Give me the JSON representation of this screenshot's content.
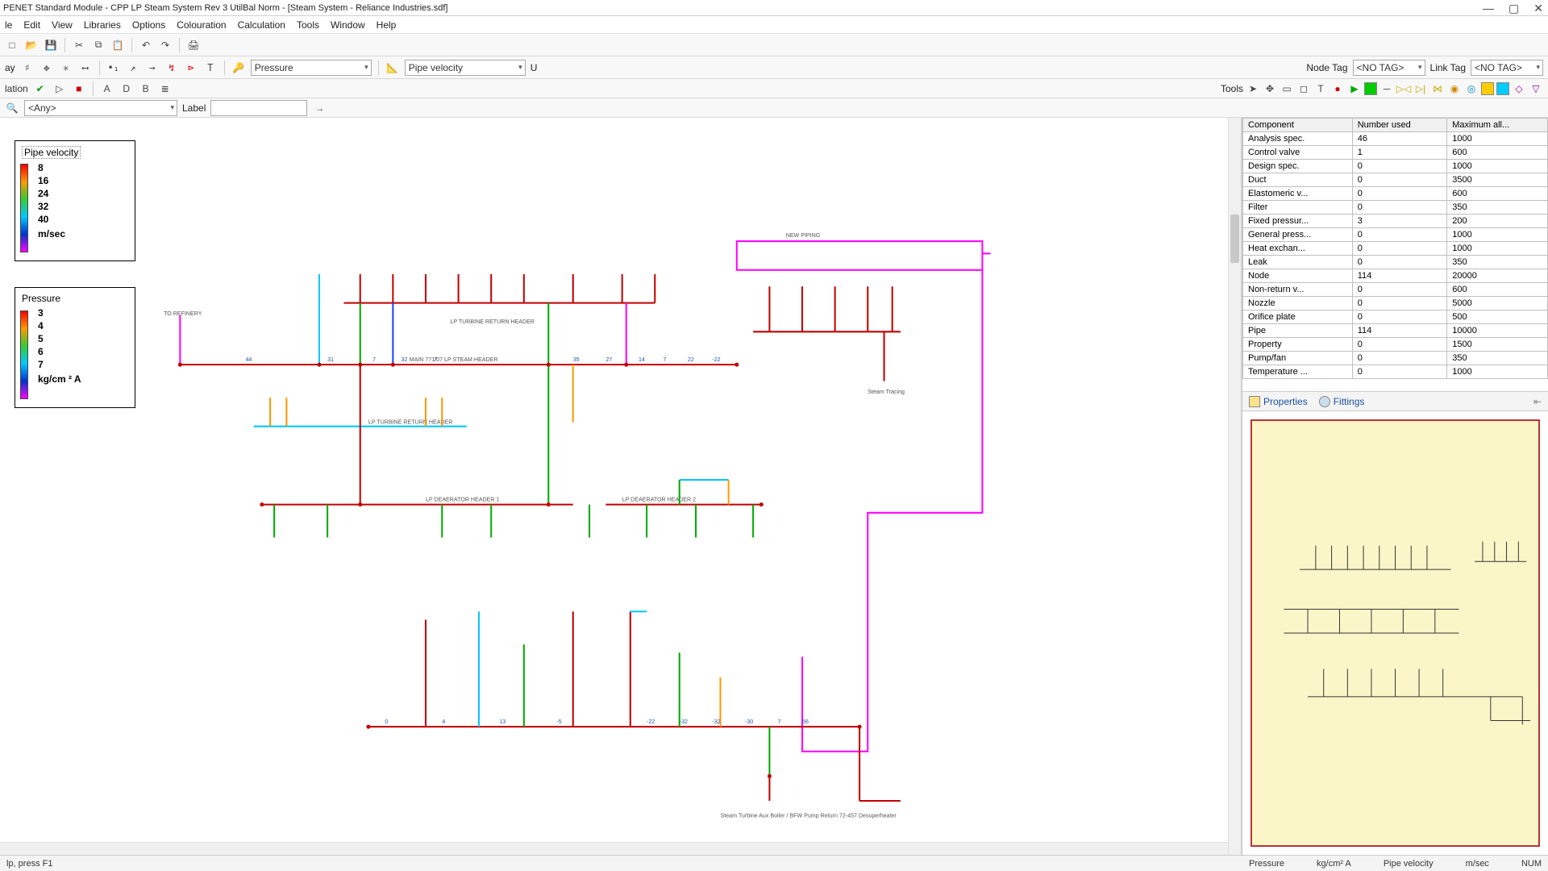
{
  "window": {
    "title": "PENET Standard Module - CPP LP Steam System Rev 3 UtilBal Norm - [Steam System - Reliance Industries.sdf]"
  },
  "menu": [
    "le",
    "Edit",
    "View",
    "Libraries",
    "Options",
    "Colouration",
    "Calculation",
    "Tools",
    "Window",
    "Help"
  ],
  "toolbar1": {
    "new": "□",
    "open": "📂",
    "save": "💾",
    "cut": "✂",
    "copy": "⧉",
    "paste": "📋",
    "undo": "↶",
    "redo": "↷",
    "print": "🖨"
  },
  "toolbar2": {
    "left_label": "ay",
    "combo1": "Pressure",
    "combo2": "Pipe velocity",
    "unit_label": "U",
    "node_tag_label": "Node Tag",
    "node_tag_value": "<NO TAG>",
    "link_tag_label": "Link Tag",
    "link_tag_value": "<NO TAG>"
  },
  "toolbar3": {
    "left": "lation",
    "tools_label": "Tools"
  },
  "toolbar4": {
    "any_combo": "<Any>",
    "label_label": "Label",
    "label_value": ""
  },
  "legend_velocity": {
    "title": "Pipe velocity",
    "ticks": [
      "8",
      "16",
      "24",
      "32",
      "40"
    ],
    "unit": "m/sec"
  },
  "legend_pressure": {
    "title": "Pressure",
    "ticks": [
      "3",
      "4",
      "5",
      "6",
      "7"
    ],
    "unit": "kg/cm ² A"
  },
  "grid": {
    "headers": [
      "Component",
      "Number used",
      "Maximum all..."
    ],
    "rows": [
      [
        "Analysis spec.",
        "46",
        "1000"
      ],
      [
        "Control valve",
        "1",
        "600"
      ],
      [
        "Design spec.",
        "0",
        "1000"
      ],
      [
        "Duct",
        "0",
        "3500"
      ],
      [
        "Elastomeric v...",
        "0",
        "600"
      ],
      [
        "Filter",
        "0",
        "350"
      ],
      [
        "Fixed pressur...",
        "3",
        "200"
      ],
      [
        "General press...",
        "0",
        "1000"
      ],
      [
        "Heat exchan...",
        "0",
        "1000"
      ],
      [
        "Leak",
        "0",
        "350"
      ],
      [
        "Node",
        "114",
        "20000"
      ],
      [
        "Non-return v...",
        "0",
        "600"
      ],
      [
        "Nozzle",
        "0",
        "5000"
      ],
      [
        "Orifice plate",
        "0",
        "500"
      ],
      [
        "Pipe",
        "114",
        "10000"
      ],
      [
        "Property",
        "0",
        "1500"
      ],
      [
        "Pump/fan",
        "0",
        "350"
      ],
      [
        "Temperature ...",
        "0",
        "1000"
      ]
    ]
  },
  "tabs": {
    "properties": "Properties",
    "fittings": "Fittings"
  },
  "status": {
    "hint": "lp, press F1",
    "pressure_lbl": "Pressure",
    "pressure_unit": "kg/cm² A",
    "velocity_lbl": "Pipe velocity",
    "velocity_unit": "m/sec",
    "num": "NUM"
  },
  "schematic_labels": {
    "main_header": "MAIN 771/07 LP STEAM HEADER",
    "return_header": "LP TURBINE RETURN HEADER",
    "dea_header_1": "LP DEAERATOR HEADER 1",
    "dea_header_2": "LP DEAERATOR HEADER 2",
    "new_piping": "NEW PIPING",
    "to_refinery": "TO REFINERY",
    "steam_tracing": "Steam Tracing",
    "steam_turbine": "Steam Turbine Aux Boiler / BFW Pump Return 72-457 Desuperheater"
  }
}
